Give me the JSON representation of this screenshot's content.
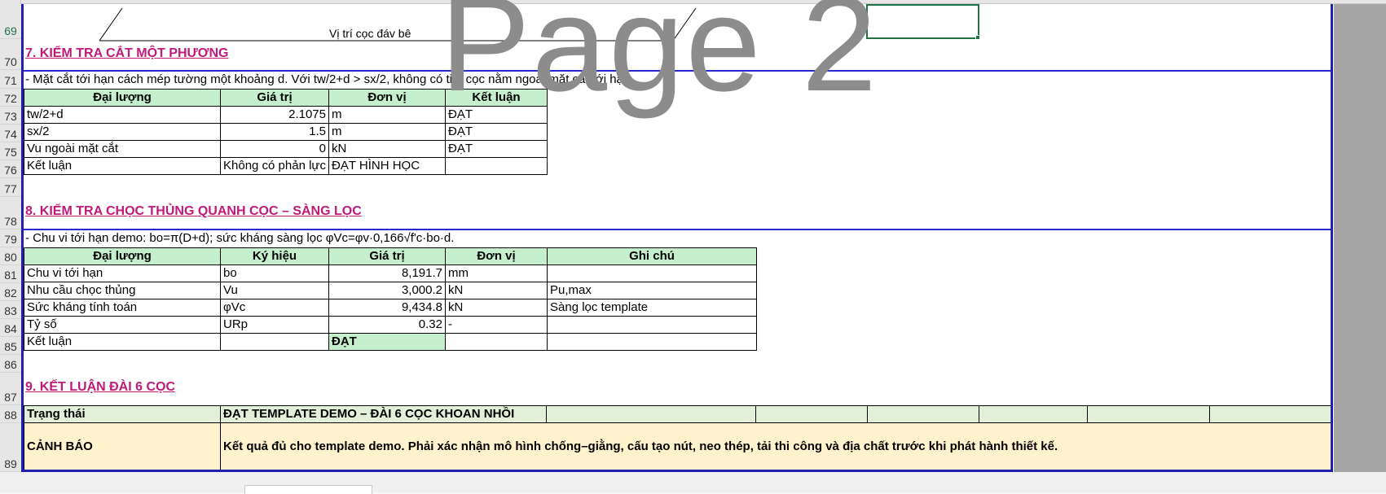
{
  "watermark": "Page 2",
  "row_numbers": [
    "69",
    "70",
    "71",
    "72",
    "73",
    "74",
    "75",
    "76",
    "77",
    "78",
    "79",
    "80",
    "81",
    "82",
    "83",
    "84",
    "85",
    "86",
    "87",
    "88",
    "89"
  ],
  "diagram_caption": "Vị trí cọc đáv bê",
  "section7": {
    "title": "7. KIỂM TRA CẮT MỘT PHƯƠNG",
    "note": "- Mặt cắt tới hạn cách mép tường một khoảng d. Với tw/2+d > sx/2, không có tim cọc nằm ngoài mặt cắt tới hạn.",
    "headers": [
      "Đại lượng",
      "Giá trị",
      "Đơn vị",
      "Kết luận"
    ],
    "rows": [
      [
        "tw/2+d",
        "2.1075",
        "m",
        "ĐẠT"
      ],
      [
        "sx/2",
        "1.5",
        "m",
        "ĐẠT"
      ],
      [
        "Vu ngoài mặt cắt",
        "0",
        "kN",
        "ĐẠT"
      ],
      [
        "Kết luận",
        "Không có phản lực cọc ngoài mặt cắt",
        "ĐẠT HÌNH HỌC",
        ""
      ]
    ]
  },
  "section8": {
    "title": "8. KIỂM TRA CHỌC THỦNG QUANH CỌC – SÀNG LỌC",
    "note": "- Chu vi tới hạn demo: bo=π(D+d); sức kháng sàng lọc φVc=φv·0,166√f'c·bo·d.",
    "headers": [
      "Đại lượng",
      "Ký hiệu",
      "Giá trị",
      "Đơn vị",
      "Ghi chú"
    ],
    "rows": [
      [
        "Chu vi tới hạn",
        "bo",
        "8,191.7",
        "mm",
        ""
      ],
      [
        "Nhu cầu chọc thủng",
        "Vu",
        "3,000.2",
        "kN",
        "Pu,max"
      ],
      [
        "Sức kháng tính toán",
        "φVc",
        "9,434.8",
        "kN",
        "Sàng lọc template"
      ],
      [
        "Tỷ số",
        "URp",
        "0.32",
        "-",
        ""
      ],
      [
        "Kết luận",
        "",
        "ĐẠT",
        "",
        ""
      ]
    ]
  },
  "section9": {
    "title": "9. KẾT LUẬN ĐÀI 6 CỌC",
    "status_label": "Trạng thái",
    "status_value": "ĐẠT TEMPLATE DEMO – ĐÀI 6 CỌC KHOAN NHỒI",
    "warning_label": "CẢNH BÁO",
    "warning_text": "Kết quả đủ cho template demo. Phải xác nhận mô hình chống–giằng, cấu tạo nút, neo thép, tải thi công và địa chất trước khi phát hành thiết kế."
  },
  "colors": {
    "section_title": "#c0197a",
    "header_fill": "#c6efce",
    "warning_fill": "#fff2cc",
    "page_border": "#1f1fb4",
    "selection": "#217346"
  }
}
